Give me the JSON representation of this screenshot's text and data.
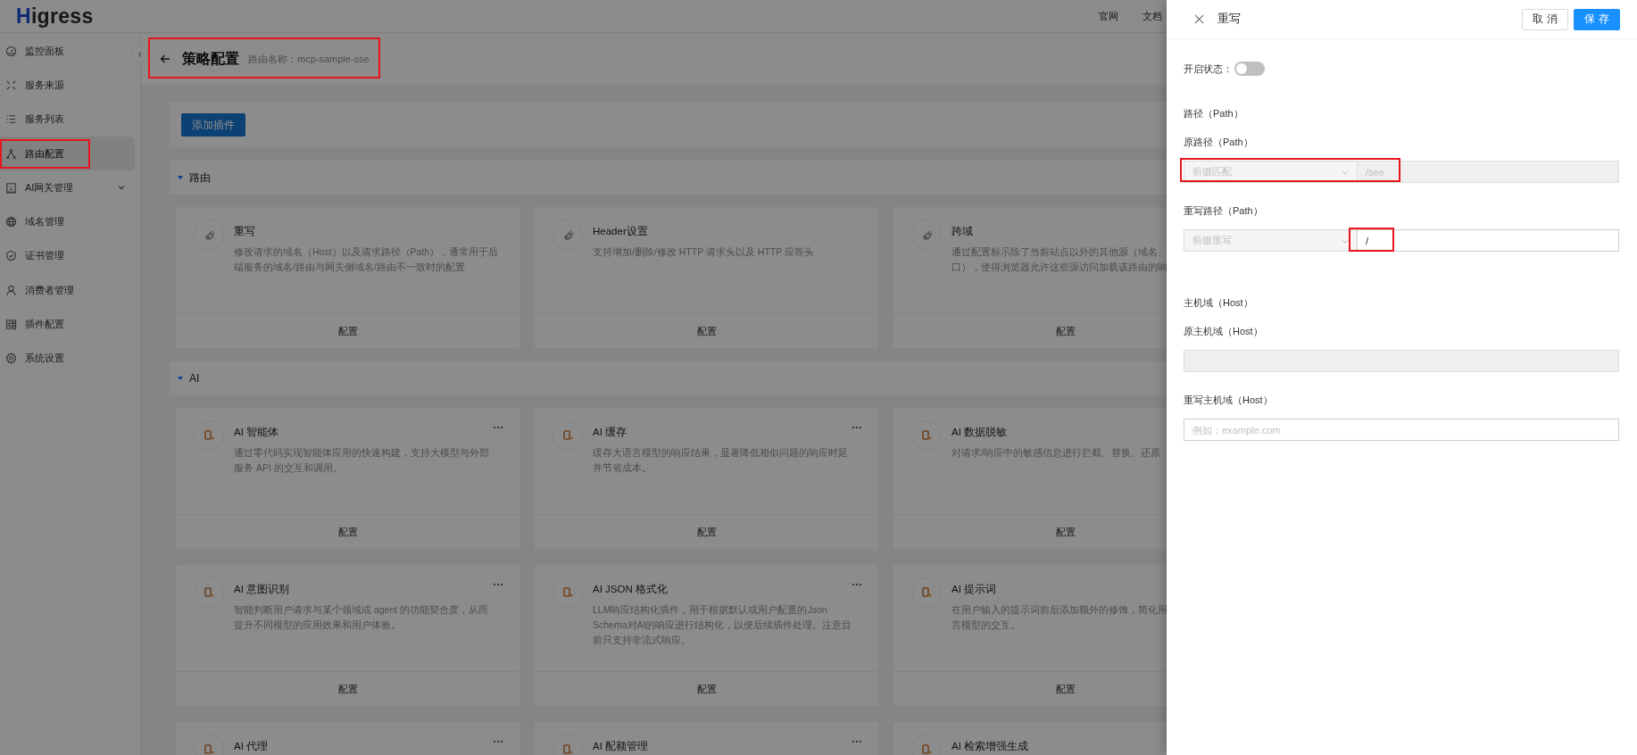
{
  "topbar": {
    "logo": "Higress",
    "nav": [
      "官网",
      "文档"
    ]
  },
  "sidebar": {
    "items": [
      {
        "label": "监控面板",
        "selected": false,
        "submenu": false,
        "highlighted": false
      },
      {
        "label": "服务来源",
        "selected": false,
        "submenu": false,
        "highlighted": false
      },
      {
        "label": "服务列表",
        "selected": false,
        "submenu": false,
        "highlighted": false
      },
      {
        "label": "路由配置",
        "selected": true,
        "submenu": false,
        "highlighted": true
      },
      {
        "label": "AI网关管理",
        "selected": false,
        "submenu": true,
        "highlighted": false
      },
      {
        "label": "域名管理",
        "selected": false,
        "submenu": false,
        "highlighted": false
      },
      {
        "label": "证书管理",
        "selected": false,
        "submenu": false,
        "highlighted": false
      },
      {
        "label": "消费者管理",
        "selected": false,
        "submenu": false,
        "highlighted": false
      },
      {
        "label": "插件配置",
        "selected": false,
        "submenu": false,
        "highlighted": false
      },
      {
        "label": "系统设置",
        "selected": false,
        "submenu": false,
        "highlighted": false
      }
    ]
  },
  "page_header": {
    "title": "策略配置",
    "subtitle": "路由名称：mcp-sample-sse",
    "highlighted": true
  },
  "add_button": "添加插件",
  "sections": [
    {
      "title": "路由",
      "kind": "route",
      "expanded": true,
      "cards": [
        {
          "title": "重写",
          "description": [
            "修改请求的域名（Host）以及请求路径（Path），通常用于后",
            "端服务的域名/路由与网关侧域名/路由不一致时的配置"
          ],
          "more": false,
          "action": "配置"
        },
        {
          "title": "Header设置",
          "description": [
            "支持增加/删除/修改 HTTP 请求头以及 HTTP 应答头"
          ],
          "more": false,
          "action": "配置"
        },
        {
          "title": "跨域",
          "description": [
            "通过配置标示除了当前站点以外的其他源（域名、",
            "口），使得浏览器允许这些源访问加载该路由的响"
          ],
          "more": false,
          "action": "配置"
        }
      ]
    },
    {
      "title": "AI",
      "kind": "ai",
      "expanded": true,
      "cards": [
        {
          "title": "AI 智能体",
          "description": [
            "通过零代码实现智能体应用的快速构建，支持大模型与外部",
            "服务 API 的交互和调用。"
          ],
          "more": true,
          "action": "配置"
        },
        {
          "title": "AI 缓存",
          "description": [
            "缓存大语言模型的响应结果，显著降低相似问题的响应时延",
            "并节省成本。"
          ],
          "more": true,
          "action": "配置"
        },
        {
          "title": "AI 数据脱敏",
          "description": [
            "对请求/响应中的敏感信息进行拦截、替换、还原"
          ],
          "more": false,
          "action": "配置"
        },
        {
          "title": "AI 意图识别",
          "description": [
            "智能判断用户请求与某个领域或 agent 的功能契合度，从而",
            "提升不同模型的应用效果和用户体验。"
          ],
          "more": true,
          "action": "配置"
        },
        {
          "title": "AI JSON 格式化",
          "description": [
            "LLM响应结构化插件，用于根据默认或用户配置的Json",
            "Schema对AI的响应进行结构化，以便后续插件处理。注意目",
            "前只支持非流式响应。"
          ],
          "more": true,
          "action": "配置"
        },
        {
          "title": "AI 提示词",
          "description": [
            "在用户输入的提示词前后添加额外的修饰，简化用",
            "言模型的交互。"
          ],
          "more": false,
          "action": "配置"
        },
        {
          "title": "AI 代理",
          "more": true
        },
        {
          "title": "AI 配额管理",
          "more": true
        },
        {
          "title": "AI 检索增强生成",
          "more": false
        }
      ]
    }
  ],
  "drawer": {
    "title": "重写",
    "buttons": [
      {
        "label": "取 消",
        "kind": "default"
      },
      {
        "label": "保 存",
        "kind": "primary"
      }
    ],
    "toggle": {
      "label": "开启状态：",
      "on": false
    },
    "groups": [
      {
        "heading": "路径（Path）",
        "fields": [
          {
            "label": "原路径（Path）",
            "kind": "select-input",
            "select": "前缀匹配",
            "value": "/see",
            "disabled": true,
            "select_highlighted": true,
            "value_highlighted": true
          },
          {
            "label": "重写路径（Path）",
            "kind": "select-input",
            "select": "前缀重写",
            "value": "/",
            "disabled": false,
            "select_highlighted": false,
            "value_highlighted": true
          }
        ]
      },
      {
        "heading": "主机域（Host）",
        "fields": [
          {
            "label": "原主机域（Host）",
            "kind": "input",
            "disabled": true
          },
          {
            "label": "重写主机域（Host）",
            "kind": "input",
            "placeholder": "例如：example.com",
            "disabled": false
          }
        ]
      }
    ]
  }
}
